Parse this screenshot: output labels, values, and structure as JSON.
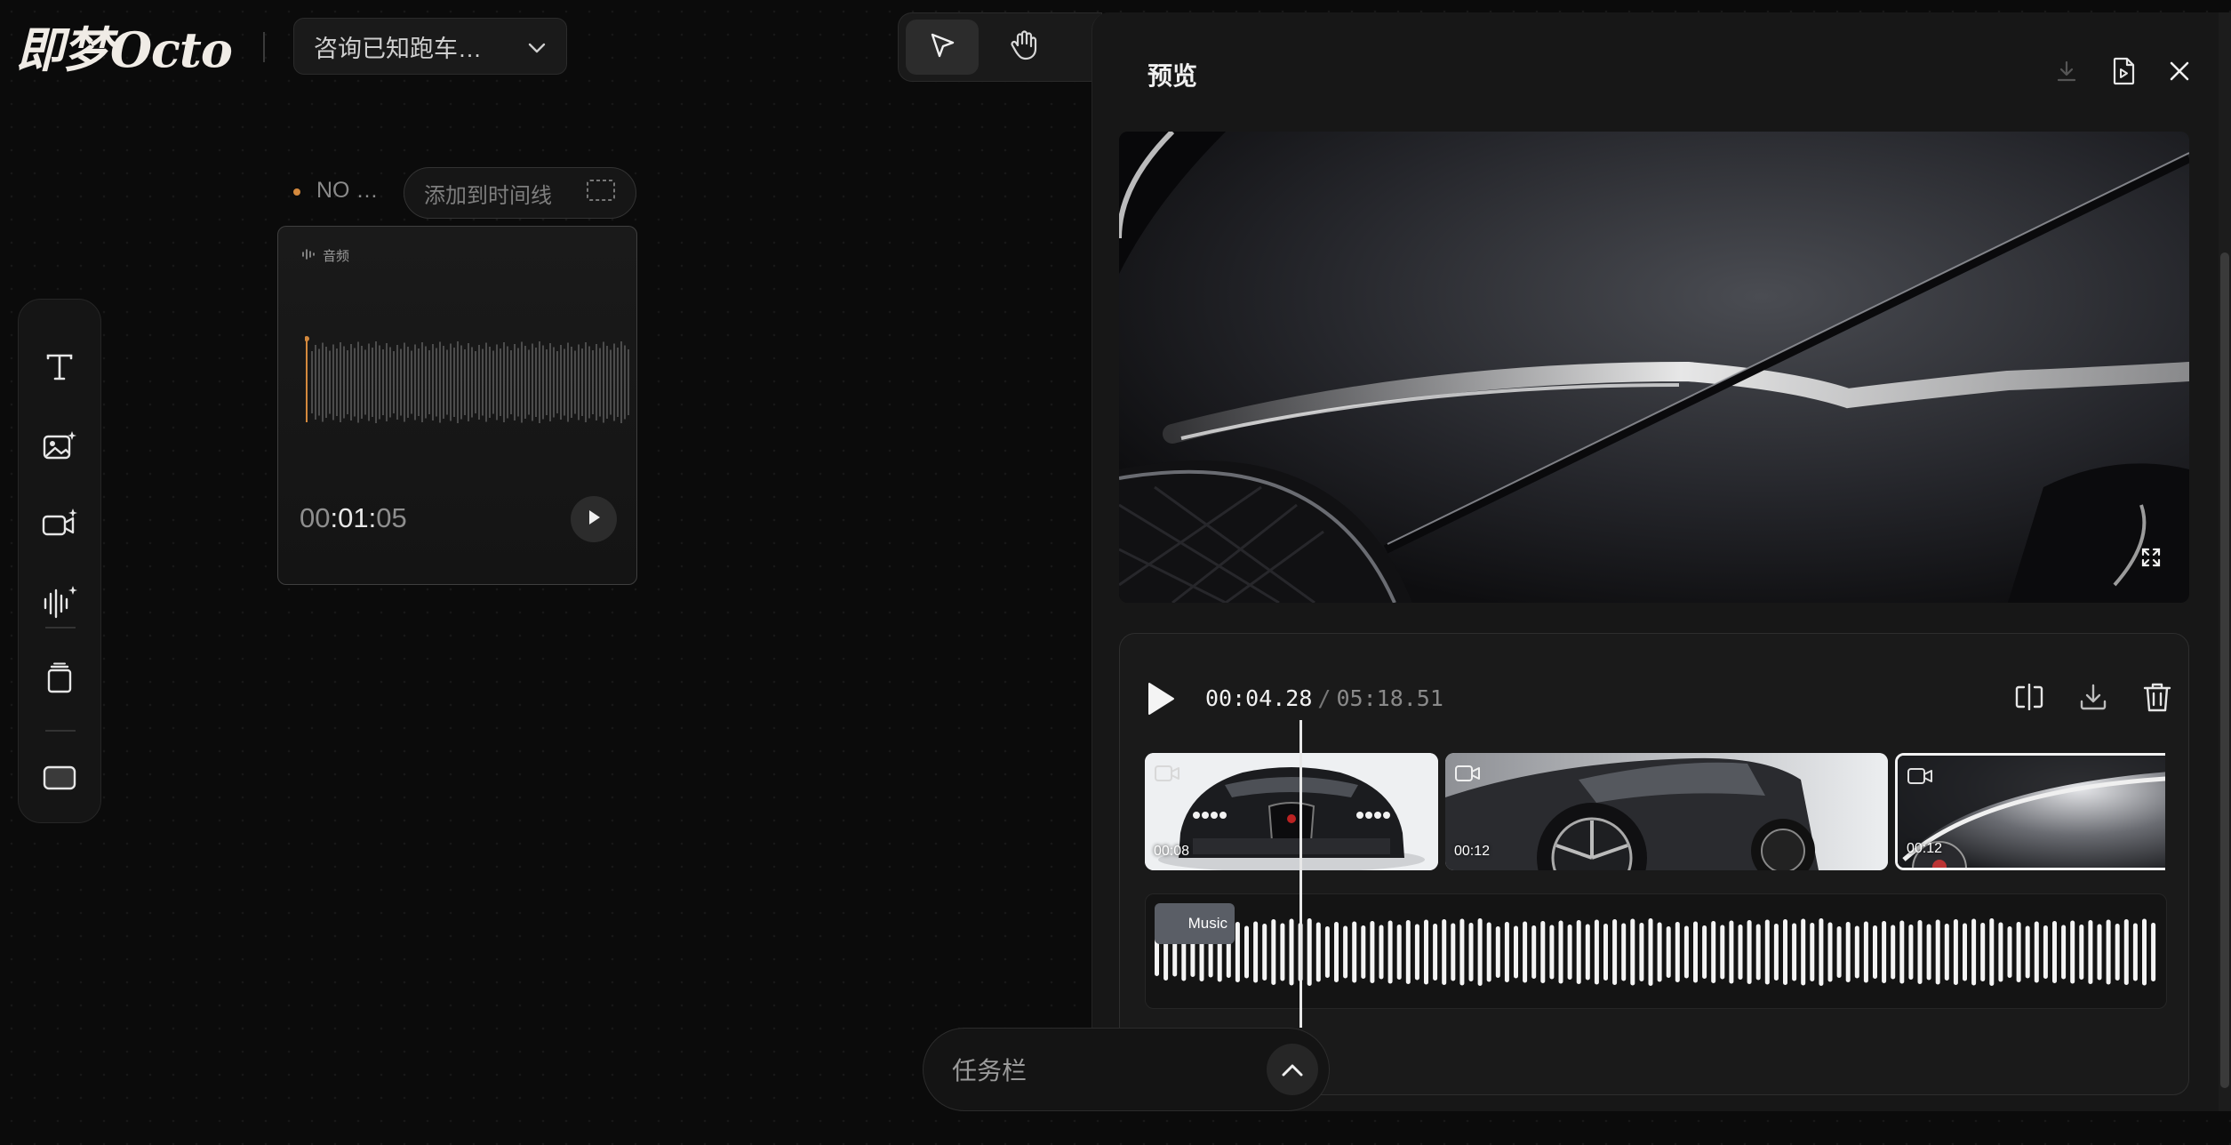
{
  "app": {
    "logo_text": "即梦Octo",
    "project_name": "咨询已知跑车…"
  },
  "canvas": {
    "node_title": "NO …",
    "add_to_timeline_label": "添加到时间线",
    "audio_card": {
      "tag_label": "音频",
      "time_hours": "00",
      "time_rest": ":01:",
      "time_seconds": "05"
    }
  },
  "left_toolbar": {
    "items": [
      "text-tool",
      "image-generate-tool",
      "video-generate-tool",
      "audio-generate-tool",
      "layers-tool",
      "frame-tool"
    ]
  },
  "preview_panel": {
    "title": "预览",
    "current_time": "00:04.28",
    "separator": "/",
    "total_time": "05:18.51",
    "clips": [
      {
        "duration": "00:08"
      },
      {
        "duration": "00:12"
      },
      {
        "duration": "00:12"
      }
    ],
    "music_label": "Music"
  },
  "taskbar": {
    "label": "任务栏"
  },
  "colors": {
    "background": "#0b0b0b",
    "panel": "#171717",
    "accent_orange": "#d4893d"
  }
}
